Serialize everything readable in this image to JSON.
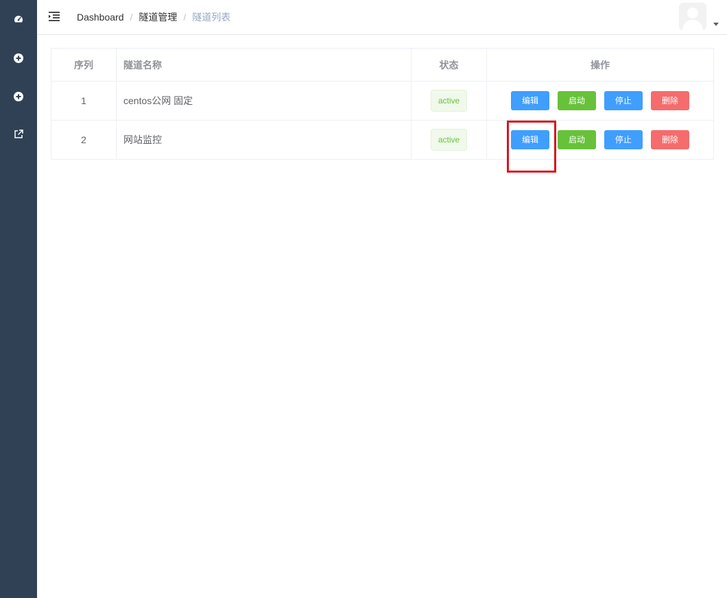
{
  "breadcrumb": [
    "Dashboard",
    "隧道管理",
    "隧道列表"
  ],
  "breadcrumb_separator": "/",
  "table": {
    "headers": [
      "序列",
      "隧道名称",
      "状态",
      "操作"
    ],
    "rows": [
      {
        "index": "1",
        "name": "centos公网 固定",
        "status": "active"
      },
      {
        "index": "2",
        "name": "网站监控",
        "status": "active"
      }
    ]
  },
  "actions": {
    "edit": "编辑",
    "start": "启动",
    "stop": "停止",
    "delete": "删除"
  },
  "sidebar_icons": [
    "dashboard-icon",
    "plus-circle-icon",
    "plus-circle-icon",
    "external-link-icon"
  ],
  "colors": {
    "sidebar_bg": "#304156",
    "primary": "#409eff",
    "success": "#67c23a",
    "danger": "#f56c6c",
    "highlight": "#d9141b"
  }
}
